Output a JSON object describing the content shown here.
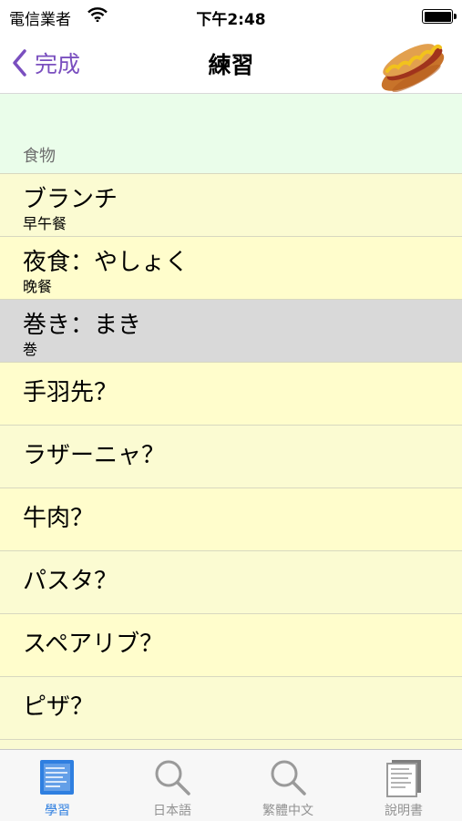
{
  "status_bar": {
    "carrier": "電信業者",
    "time": "下午2:48"
  },
  "nav": {
    "back_label": "完成",
    "title": "練習",
    "accent_color": "#7a4fbf"
  },
  "section": {
    "header": "食物"
  },
  "rows": [
    {
      "term": "ブランチ",
      "meaning": "早午餐"
    },
    {
      "term": "夜食：やしょく",
      "meaning": "晚餐"
    },
    {
      "term": "巻き：まき",
      "meaning": "巻"
    },
    {
      "term": "手羽先？"
    },
    {
      "term": "ラザーニャ？"
    },
    {
      "term": "牛肉？"
    },
    {
      "term": "パスタ？"
    },
    {
      "term": "スペアリブ？"
    },
    {
      "term": "ピザ？"
    }
  ],
  "tabs": [
    {
      "label": "學習",
      "icon": "notebook-icon",
      "active": true
    },
    {
      "label": "日本語",
      "icon": "magnifier-icon",
      "active": false
    },
    {
      "label": "繁體中文",
      "icon": "magnifier-icon",
      "active": false
    },
    {
      "label": "說明書",
      "icon": "document-icon",
      "active": false
    }
  ],
  "colors": {
    "row_yellow": "#fffdcc",
    "row_light": "#fbfbd2",
    "row_selected": "#d9d9d9",
    "section_bg": "#eafdea",
    "tab_active": "#2f7fe0"
  }
}
